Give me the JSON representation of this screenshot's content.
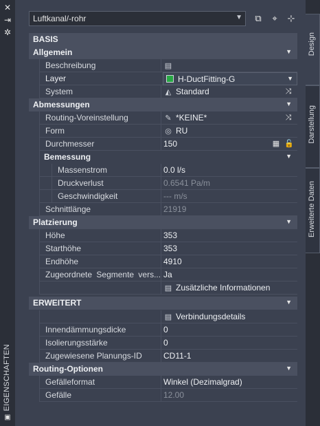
{
  "left_panel": {
    "title": "EIGENSCHAFTEN"
  },
  "right_tabs": [
    "Design",
    "Darstellung",
    "Erweiterte Daten"
  ],
  "toolbar": {
    "selected": "Luftkanal/-rohr"
  },
  "sections": {
    "basis": "BASIS",
    "allgemein": "Allgemein",
    "abmessungen": "Abmessungen",
    "bemessung": "Bemessung",
    "platzierung": "Platzierung",
    "erweitert": "ERWEITERT",
    "routing": "Routing-Optionen"
  },
  "allgemein": {
    "beschreibung_label": "Beschreibung",
    "layer_label": "Layer",
    "layer_value": "H-DuctFitting-G",
    "system_label": "System",
    "system_value": "Standard"
  },
  "abmessungen": {
    "routing_label": "Routing-Voreinstellung",
    "routing_value": "*KEINE*",
    "form_label": "Form",
    "form_value": "RU",
    "durchmesser_label": "Durchmesser",
    "durchmesser_value": "150",
    "massenstrom_label": "Massenstrom",
    "massenstrom_value": "0.0 l/s",
    "druckverlust_label": "Druckverlust",
    "druckverlust_value": "0.6541 Pa/m",
    "geschwindigkeit_label": "Geschwindigkeit",
    "geschwindigkeit_value": "--- m/s",
    "schnitt_label": "Schnittlänge",
    "schnitt_value": "21919"
  },
  "platzierung": {
    "hoehe_label": "Höhe",
    "hoehe_value": "353",
    "start_label": "Starthöhe",
    "start_value": "353",
    "end_label": "Endhöhe",
    "end_value": "4910",
    "zug_label": "Zugeordnete Segmente vers...",
    "zug_value": "Ja",
    "info_label": "Zusätzliche Informationen"
  },
  "erweitert": {
    "verbindung_label": "Verbindungsdetails",
    "innen_label": "Innendämmungsdicke",
    "innen_value": "0",
    "iso_label": "Isolierungsstärke",
    "iso_value": "0",
    "plan_label": "Zugewiesene Planungs-ID",
    "plan_value": "CD11-1"
  },
  "routing": {
    "format_label": "Gefälleformat",
    "format_value": "Winkel (Dezimalgrad)",
    "gefaelle_label": "Gefälle",
    "gefaelle_value": "12.00"
  },
  "colors": {
    "layer_swatch": "#27a844",
    "accent_dark": "#2b2f38",
    "section_bg": "#4a5060"
  }
}
